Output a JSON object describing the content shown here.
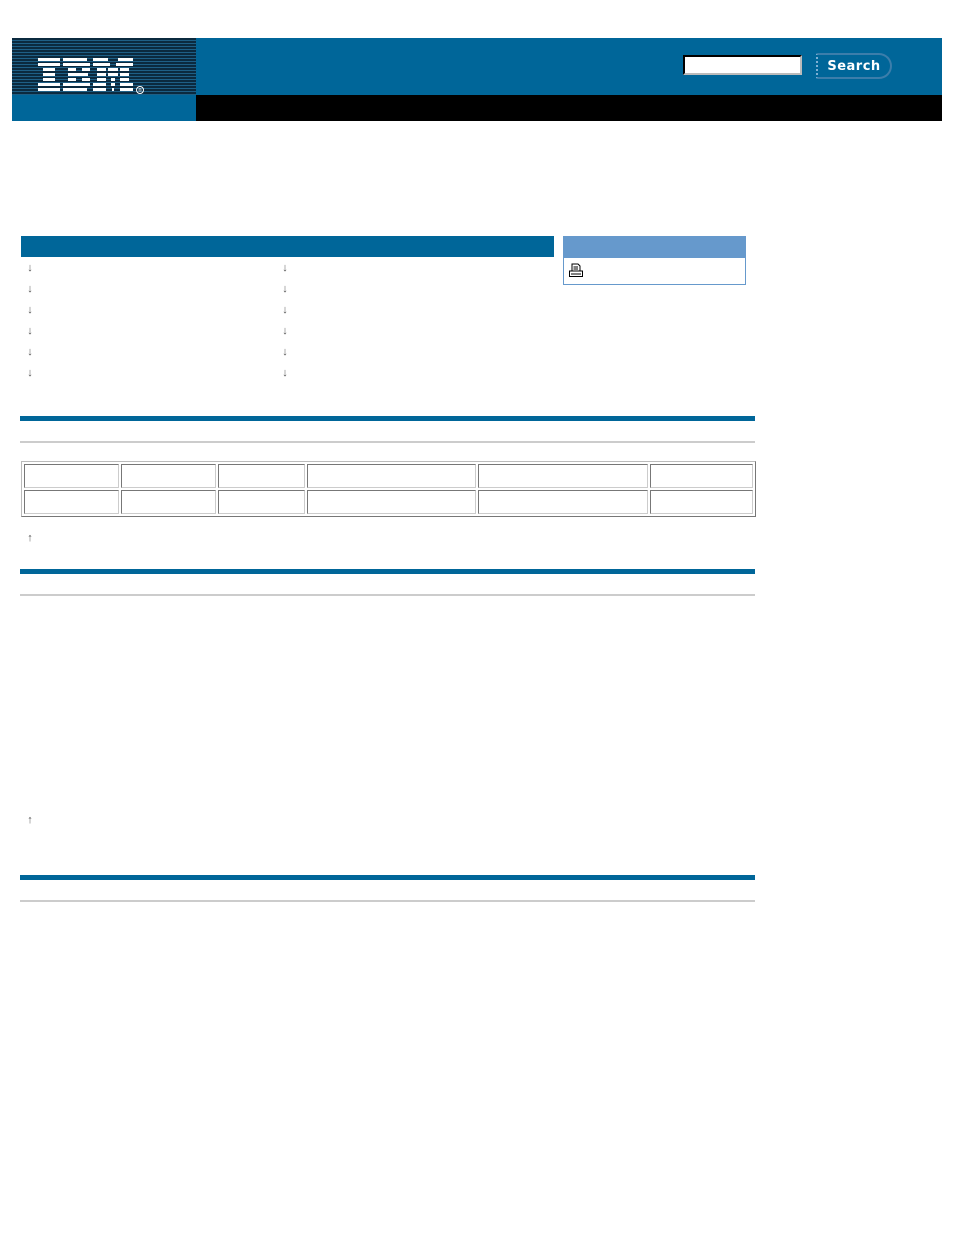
{
  "masthead": {
    "brand": "IBM",
    "brand_mark": "®",
    "logo_icon": "ibm-logo",
    "search": {
      "value": "",
      "placeholder": "",
      "button_label": "Search"
    },
    "colors": {
      "primary": "#006699",
      "black_bar": "#000000",
      "stripe_dark": "#0b2a3f",
      "stripe_light": "#1e5f86"
    }
  },
  "page": {
    "title": ""
  },
  "toc": {
    "header": "",
    "link_icon": "arrow-down-icon",
    "columns": [
      {
        "items": [
          {
            "label": ""
          },
          {
            "label": ""
          },
          {
            "label": ""
          },
          {
            "label": ""
          },
          {
            "label": ""
          },
          {
            "label": ""
          }
        ]
      },
      {
        "items": [
          {
            "label": ""
          },
          {
            "label": ""
          },
          {
            "label": ""
          },
          {
            "label": ""
          },
          {
            "label": ""
          },
          {
            "label": ""
          }
        ]
      }
    ]
  },
  "document_options": {
    "header": "",
    "header_color": "#6699cc",
    "items": [
      {
        "icon": "printer-icon",
        "label": ""
      }
    ]
  },
  "sections": [
    {
      "title": "",
      "table": {
        "rows": [
          [
            "",
            "",
            "",
            "",
            "",
            ""
          ],
          [
            "",
            "",
            "",
            "",
            "",
            ""
          ]
        ]
      },
      "back_to_top": {
        "icon": "arrow-up-icon",
        "label": ""
      }
    },
    {
      "title": "",
      "body": "",
      "back_to_top": {
        "icon": "arrow-up-icon",
        "label": ""
      }
    },
    {
      "title": "",
      "body": ""
    }
  ]
}
